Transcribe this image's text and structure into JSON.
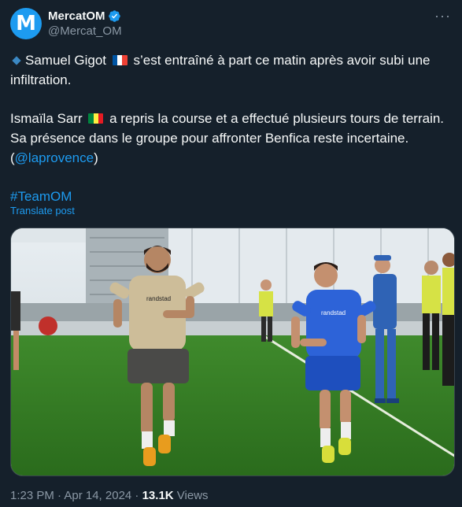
{
  "account": {
    "name": "MercatOM",
    "handle": "@Mercat_OM",
    "avatar_letter": "M",
    "verified": true
  },
  "tweet": {
    "line1_a": "Samuel Gigot",
    "line1_b": "s’est entraîné à part ce matin après avoir subi une infiltration.",
    "line2_a": "Ismaïla Sarr",
    "line2_b": "a repris la course et a effectué plusieurs tours de terrain. Sa présence dans le groupe pour affronter Benfica reste incertaine. (",
    "mention": "@laprovence",
    "line2_close": ")",
    "hashtag": "#TeamOM",
    "flag_fr": [
      "#0055a4",
      "#ffffff",
      "#ef4135"
    ],
    "flag_sn": [
      "#00853f",
      "#fdef42",
      "#e31b23"
    ]
  },
  "translate_label": "Translate post",
  "meta": {
    "time": "1:23 PM · Apr 14, 2024 · ",
    "views_count": "13.1K",
    "views_label": " Views"
  },
  "photo": {
    "shirt_left": "randstad",
    "shirt_right": "randstad"
  },
  "colors": {
    "background": "#15202b",
    "accent": "#1d9bf0",
    "muted": "#8b98a5"
  }
}
